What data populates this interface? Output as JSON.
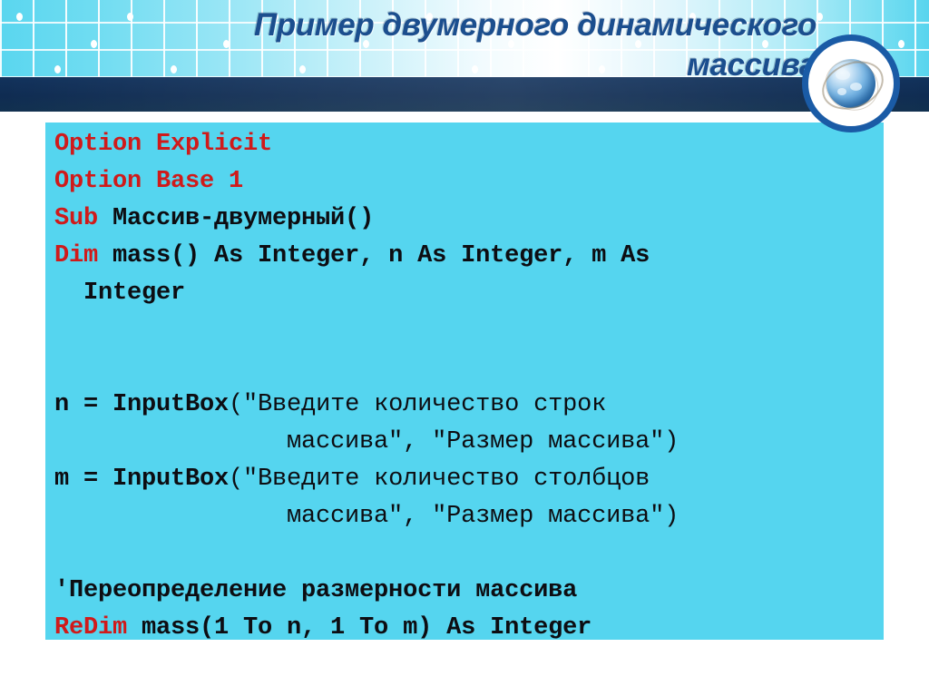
{
  "slide": {
    "title_line1": "Пример двумерного динамического",
    "title_line2": "массива",
    "title_color": "#1b4e8e",
    "banner_accent_color": "#12325c",
    "code_background_color": "#55d5ef",
    "keyword_color": "#d01a1a",
    "code_text_color": "#0d0d12"
  },
  "decor": {
    "globe_icon": "globe-icon",
    "globe_badge_ring_color": "#1a5ba6"
  },
  "code": {
    "lines": [
      {
        "id": "l1",
        "kind": "code",
        "keyword": "Option",
        "rest": " Explicit",
        "keyword_only": true
      },
      {
        "id": "l2",
        "kind": "code",
        "keyword": "Option",
        "rest": " Base 1",
        "keyword_only": true
      },
      {
        "id": "l3",
        "kind": "code",
        "keyword": "Sub",
        "rest": " Массив-двумерный()"
      },
      {
        "id": "l4",
        "kind": "code",
        "keyword": "Dim",
        "rest": " mass() As Integer, n As Integer, m As"
      },
      {
        "id": "l5",
        "kind": "cont",
        "text": "  Integer"
      },
      {
        "id": "l6",
        "kind": "blank",
        "text": ""
      },
      {
        "id": "l7",
        "kind": "blank",
        "text": ""
      },
      {
        "id": "l8",
        "kind": "mixed",
        "bold": "n = InputBox",
        "plain": "(\"Введите количество строк"
      },
      {
        "id": "l9",
        "kind": "cont",
        "text": "                массива\", \"Размер массива\")"
      },
      {
        "id": "l10",
        "kind": "mixed",
        "bold": "m = InputBox",
        "plain": "(\"Введите количество столбцов"
      },
      {
        "id": "l11",
        "kind": "cont",
        "text": "                массива\", \"Размер массива\")"
      },
      {
        "id": "l12",
        "kind": "blank",
        "text": ""
      },
      {
        "id": "l13",
        "kind": "comment",
        "text": "'Переопределение размерности массива"
      },
      {
        "id": "l14",
        "kind": "code",
        "keyword": "ReDim",
        "rest": " mass(1 To n, 1 To m) As Integer"
      }
    ],
    "line_1_keyword": "Option",
    "line_1_rest": " Explicit",
    "line_2_keyword": "Option",
    "line_2_rest": " Base 1",
    "line_3_keyword": "Sub",
    "line_3_rest": " Массив-двумерный()",
    "line_4_keyword": "Dim",
    "line_4_rest": " mass() As Integer, n As Integer, m As",
    "line_5_text": "  Integer",
    "line_8_bold": "n = InputBox",
    "line_8_plain": "(\"Введите количество строк",
    "line_9_text": "                массива\", \"Размер массива\")",
    "line_10_bold": "m = InputBox",
    "line_10_plain": "(\"Введите количество столбцов",
    "line_11_text": "                массива\", \"Размер массива\")",
    "line_13_text": "'Переопределение размерности массива",
    "line_14_keyword": "ReDim",
    "line_14_rest": " mass(1 To n, 1 To m) As Integer"
  }
}
